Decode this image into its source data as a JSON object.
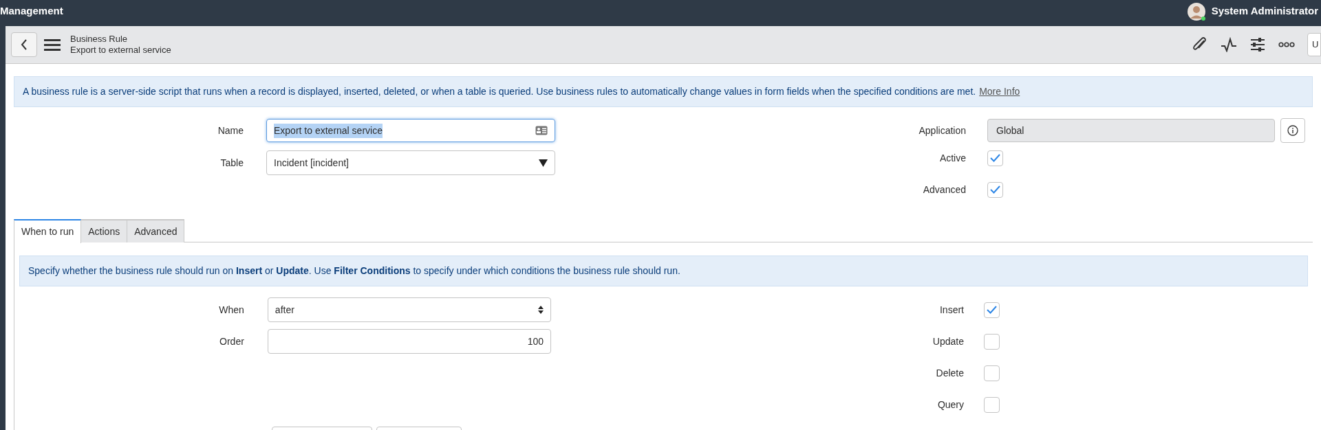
{
  "top_bar": {
    "title": "Management",
    "user": "System Administrator"
  },
  "header": {
    "title": "Business Rule",
    "subtitle": "Export to external service",
    "cut_button": "U"
  },
  "info": {
    "text": "A business rule is a server-side script that runs when a record is displayed, inserted, deleted, or when a table is queried. Use business rules to automatically change values in form fields when the specified conditions are met.",
    "link": "More Info"
  },
  "name": {
    "label": "Name",
    "value": "Export to external service"
  },
  "table": {
    "label": "Table",
    "value": "Incident [incident]"
  },
  "application": {
    "label": "Application",
    "value": "Global"
  },
  "flags": [
    {
      "label": "Active",
      "checked": true
    },
    {
      "label": "Advanced",
      "checked": true
    }
  ],
  "tabs": [
    {
      "label": "When to run",
      "selected": true
    },
    {
      "label": "Actions",
      "selected": false
    },
    {
      "label": "Advanced",
      "selected": false
    }
  ],
  "tab_info": "Specify whether the business rule should run on **Insert** or **Update**. Use **Filter Conditions** to specify under which conditions the business rule should run.",
  "when": {
    "label": "When",
    "value": "after"
  },
  "order": {
    "label": "Order",
    "value": "100"
  },
  "operations": [
    {
      "label": "Insert",
      "checked": true
    },
    {
      "label": "Update",
      "checked": false
    },
    {
      "label": "Delete",
      "checked": false
    },
    {
      "label": "Query",
      "checked": false
    }
  ]
}
